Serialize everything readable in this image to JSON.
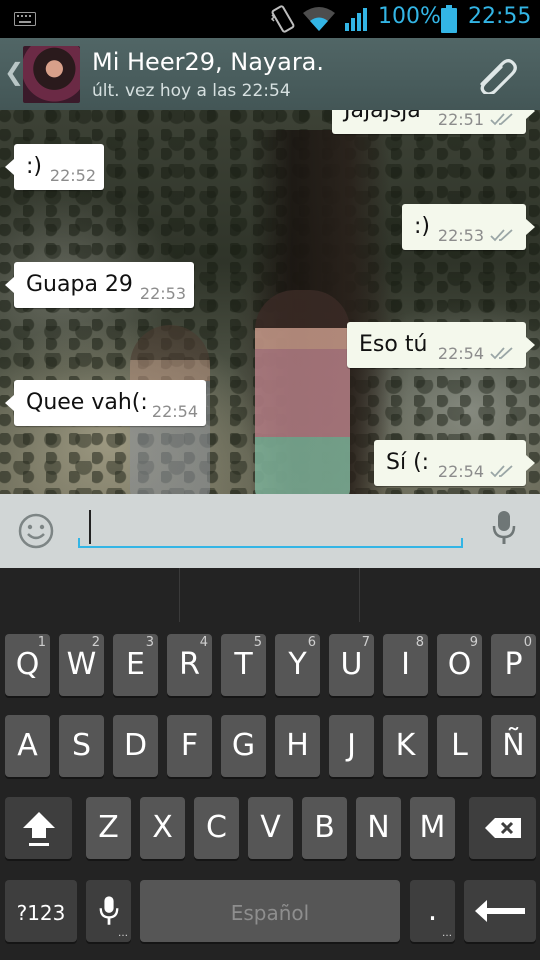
{
  "status_bar": {
    "battery_percent": "100%",
    "time": "22:55"
  },
  "header": {
    "contact_name": "Mi Heer29, Nayara.",
    "last_seen": "últ. vez hoy a las 22:54"
  },
  "messages": [
    {
      "direction": "out",
      "text": "Jajajsja",
      "time": "22:51"
    },
    {
      "direction": "in",
      "text": ":)",
      "time": "22:52"
    },
    {
      "direction": "out",
      "text": ":)",
      "time": "22:53"
    },
    {
      "direction": "in",
      "text": "Guapa 29",
      "time": "22:53"
    },
    {
      "direction": "out",
      "text": "Eso tú",
      "time": "22:54"
    },
    {
      "direction": "in",
      "text": "Quee vah(:",
      "time": "22:54"
    },
    {
      "direction": "out",
      "text": "Sí (:",
      "time": "22:54"
    }
  ],
  "compose": {
    "value": ""
  },
  "keyboard": {
    "row1": [
      {
        "key": "Q",
        "alt": "1"
      },
      {
        "key": "W",
        "alt": "2"
      },
      {
        "key": "E",
        "alt": "3"
      },
      {
        "key": "R",
        "alt": "4"
      },
      {
        "key": "T",
        "alt": "5"
      },
      {
        "key": "Y",
        "alt": "6"
      },
      {
        "key": "U",
        "alt": "7"
      },
      {
        "key": "I",
        "alt": "8"
      },
      {
        "key": "O",
        "alt": "9"
      },
      {
        "key": "P",
        "alt": "0"
      }
    ],
    "row2": [
      "A",
      "S",
      "D",
      "F",
      "G",
      "H",
      "J",
      "K",
      "L",
      "Ñ"
    ],
    "row3": [
      "Z",
      "X",
      "C",
      "V",
      "B",
      "N",
      "M"
    ],
    "symbols_label": "?123",
    "space_label": "Español",
    "period_label": "."
  },
  "colors": {
    "accent": "#33b5e5",
    "header": "#4a5e5e",
    "outgoing_bubble": "#f4f8ec",
    "key": "#565656"
  }
}
